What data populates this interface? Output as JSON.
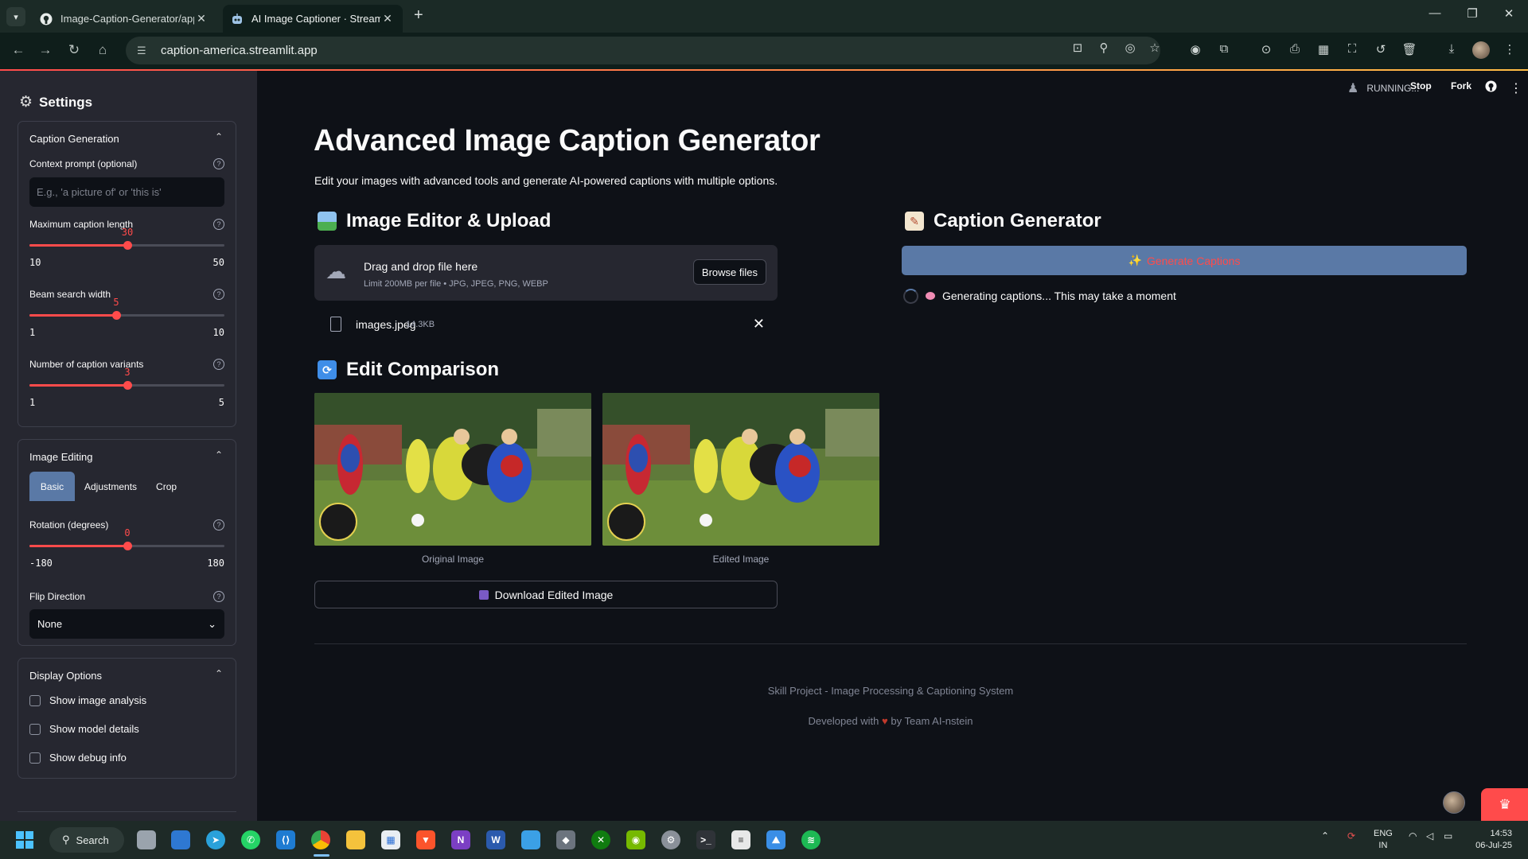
{
  "browser": {
    "tabs": [
      {
        "title": "Image-Caption-Generator/app",
        "active": false
      },
      {
        "title": "AI Image Captioner · Streamlit",
        "active": true
      }
    ],
    "url": "caption-america.streamlit.app"
  },
  "sidebar": {
    "title": "Settings",
    "caption_generation": {
      "header": "Caption Generation",
      "context_prompt": {
        "label": "Context prompt (optional)",
        "placeholder": "E.g., 'a picture of' or 'this is'"
      },
      "max_length": {
        "label": "Maximum caption length",
        "value": "30",
        "min": "10",
        "max": "50",
        "fraction": 0.5
      },
      "beam_width": {
        "label": "Beam search width",
        "value": "5",
        "min": "1",
        "max": "10",
        "fraction": 0.444
      },
      "variants": {
        "label": "Number of caption variants",
        "value": "3",
        "min": "1",
        "max": "5",
        "fraction": 0.5
      }
    },
    "image_editing": {
      "header": "Image Editing",
      "tabs": [
        "Basic",
        "Adjustments",
        "Crop"
      ],
      "rotation": {
        "label": "Rotation (degrees)",
        "value": "0",
        "min": "-180",
        "max": "180",
        "fraction": 0.5
      },
      "flip": {
        "label": "Flip Direction",
        "value": "None"
      }
    },
    "display_options": {
      "header": "Display Options",
      "checkboxes": [
        "Show image analysis",
        "Show model details",
        "Show debug info"
      ]
    }
  },
  "header": {
    "status": "RUNNING...",
    "stop": "Stop",
    "fork": "Fork"
  },
  "main": {
    "title": "Advanced Image Caption Generator",
    "subtitle": "Edit your images with advanced tools and generate AI-powered captions with multiple options.",
    "editor_heading": "Image Editor & Upload",
    "uploader": {
      "drag_text": "Drag and drop file here",
      "limit_text": "Limit 200MB per file • JPG, JPEG, PNG, WEBP",
      "browse": "Browse files"
    },
    "file": {
      "name": "images.jpeg",
      "size": "14.3KB"
    },
    "comparison_heading": "Edit Comparison",
    "original_caption": "Original Image",
    "edited_caption": "Edited Image",
    "download": "Download Edited Image",
    "caption_heading": "Caption Generator",
    "generate_button": "Generate Captions",
    "generating_text": "Generating captions... This may take a moment",
    "footer_line1": "Skill Project - Image Processing & Captioning System",
    "footer_line2_pre": "Developed with",
    "footer_line2_post": "by Team AI-nstein"
  },
  "taskbar": {
    "search": "Search",
    "lang1": "ENG",
    "lang2": "IN",
    "time": "14:53",
    "date": "06-Jul-25"
  },
  "colors": {
    "accent": "#ff4b4b",
    "primary_button": "#5a79a6",
    "sidebar_bg": "#262730",
    "main_bg": "#0e1117"
  }
}
